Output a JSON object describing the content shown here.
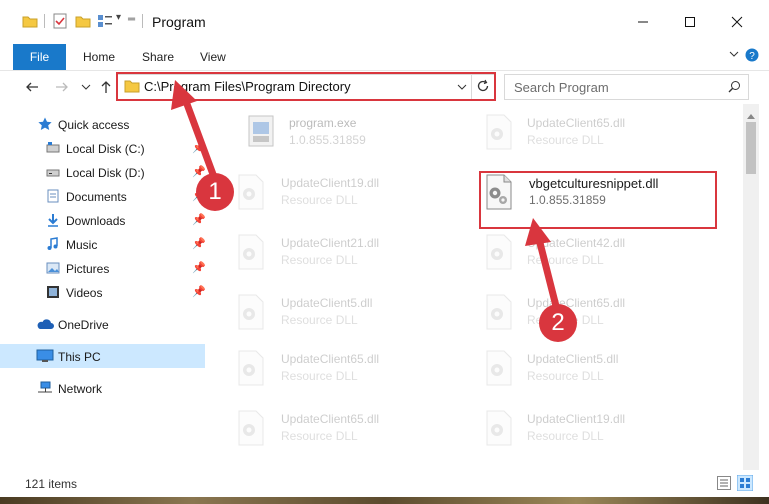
{
  "window": {
    "title": "Program"
  },
  "ribbon": {
    "file": "File",
    "tabs": [
      "Home",
      "Share",
      "View"
    ]
  },
  "address": {
    "path": "C:\\Program Files\\Program Directory"
  },
  "search": {
    "placeholder": "Search Program"
  },
  "nav": {
    "items": [
      {
        "label": "Quick access",
        "icon": "star-icon",
        "pinned": false
      },
      {
        "label": "Local Disk (C:)",
        "icon": "drive-icon",
        "pinned": true
      },
      {
        "label": "Local Disk (D:)",
        "icon": "drive-icon",
        "pinned": true
      },
      {
        "label": "Documents",
        "icon": "documents-icon",
        "pinned": true
      },
      {
        "label": "Downloads",
        "icon": "download-icon",
        "pinned": true
      },
      {
        "label": "Music",
        "icon": "music-icon",
        "pinned": true
      },
      {
        "label": "Pictures",
        "icon": "pictures-icon",
        "pinned": true
      },
      {
        "label": "Videos",
        "icon": "videos-icon",
        "pinned": true
      },
      {
        "label": "OneDrive",
        "icon": "cloud-icon",
        "pinned": false
      },
      {
        "label": "This PC",
        "icon": "computer-icon",
        "pinned": false,
        "selected": true
      },
      {
        "label": "Network",
        "icon": "network-icon",
        "pinned": false
      }
    ]
  },
  "files": {
    "left": [
      {
        "name": "program.exe",
        "sub": "1.0.855.31859"
      },
      {
        "name": "UpdateClient19.dll",
        "sub": "Resource DLL"
      },
      {
        "name": "UpdateClient21.dll",
        "sub": "Resource DLL"
      },
      {
        "name": "UpdateClient5.dll",
        "sub": "Resource DLL"
      },
      {
        "name": "UpdateClient65.dll",
        "sub": "Resource DLL"
      },
      {
        "name": "UpdateClient65.dll",
        "sub": "Resource DLL"
      }
    ],
    "right": [
      {
        "name": "UpdateClient65.dll",
        "sub": "Resource DLL"
      },
      {
        "name": "vbgetculturesnippet.dll",
        "sub": "1.0.855.31859",
        "highlight": true
      },
      {
        "name": "UpdateClient42.dll",
        "sub": "Resource DLL"
      },
      {
        "name": "UpdateClient65.dll",
        "sub": "Resource DLL"
      },
      {
        "name": "UpdateClient5.dll",
        "sub": "Resource DLL"
      },
      {
        "name": "UpdateClient19.dll",
        "sub": "Resource DLL"
      }
    ]
  },
  "status": {
    "count": "121 items"
  },
  "callouts": {
    "one": "1",
    "two": "2"
  },
  "colors": {
    "accent": "#1979ca",
    "callout": "#d9363e",
    "selection": "#cce8ff"
  }
}
